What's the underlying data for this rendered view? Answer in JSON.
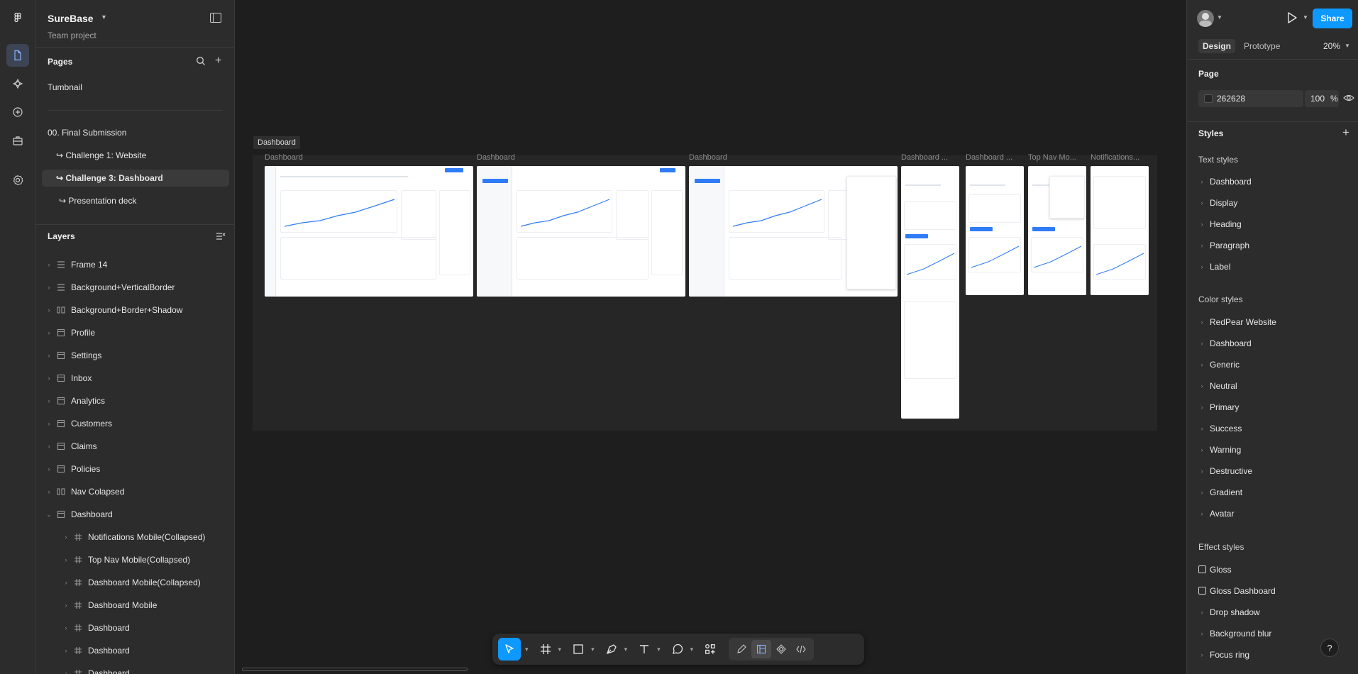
{
  "app": {
    "file_title": "SureBase",
    "team_label": "Team project"
  },
  "pages": {
    "header": "Pages",
    "items": [
      {
        "label": "Tumbnail"
      },
      {
        "label": "00. Final Submission"
      },
      {
        "label": "↪ Challenge 1: Website"
      },
      {
        "label": "↪ Challenge 3: Dashboard"
      },
      {
        "label": "↪ Presentation deck"
      }
    ]
  },
  "layers": {
    "header": "Layers",
    "items": [
      {
        "label": "Frame 14",
        "icon": "frame-stack-icon"
      },
      {
        "label": "Background+VerticalBorder",
        "icon": "frame-stack-icon"
      },
      {
        "label": "Background+Border+Shadow",
        "icon": "auto-layout-icon"
      },
      {
        "label": "Profile",
        "icon": "frame-icon"
      },
      {
        "label": "Settings",
        "icon": "frame-icon"
      },
      {
        "label": "Inbox",
        "icon": "frame-icon"
      },
      {
        "label": "Analytics",
        "icon": "frame-icon"
      },
      {
        "label": "Customers",
        "icon": "frame-icon"
      },
      {
        "label": "Claims",
        "icon": "frame-icon"
      },
      {
        "label": "Policies",
        "icon": "frame-icon"
      },
      {
        "label": "Nav Colapsed",
        "icon": "auto-layout-icon"
      },
      {
        "label": "Dashboard",
        "icon": "frame-icon"
      },
      {
        "label": "Notifications Mobile(Collapsed)",
        "icon": "hash-icon"
      },
      {
        "label": "Top Nav Mobile(Collapsed)",
        "icon": "hash-icon"
      },
      {
        "label": "Dashboard Mobile(Collapsed)",
        "icon": "hash-icon"
      },
      {
        "label": "Dashboard Mobile",
        "icon": "hash-icon"
      },
      {
        "label": "Dashboard",
        "icon": "hash-icon"
      },
      {
        "label": "Dashboard",
        "icon": "hash-icon"
      },
      {
        "label": "Dashboard",
        "icon": "hash-icon"
      }
    ]
  },
  "canvas": {
    "section_label": "Dashboard",
    "frame_labels": [
      "Dashboard",
      "Dashboard",
      "Dashboard",
      "Dashboard ...",
      "Dashboard ...",
      "Top Nav Mo...",
      "Notifications..."
    ]
  },
  "right": {
    "tabs": [
      "Design",
      "Prototype"
    ],
    "zoom": "20%",
    "share_label": "Share",
    "page_header": "Page",
    "page_color": "262628",
    "page_opacity": "100",
    "percent_sign": "%",
    "styles_header": "Styles",
    "text_styles_header": "Text styles",
    "text_styles": [
      "Dashboard",
      "Display",
      "Heading",
      "Paragraph",
      "Label"
    ],
    "color_styles_header": "Color styles",
    "color_styles": [
      "RedPear Website",
      "Dashboard",
      "Generic",
      "Neutral",
      "Primary",
      "Success",
      "Warning",
      "Destructive",
      "Gradient",
      "Avatar"
    ],
    "effect_styles_header": "Effect styles",
    "effect_styles": [
      "Gloss",
      "Gloss Dashboard",
      "Drop shadow",
      "Background blur",
      "Focus ring"
    ],
    "help_label": "?"
  },
  "colors": {
    "accent": "#0d99ff",
    "canvas_bg": "#1e1e1e",
    "panel_bg": "#2c2c2c"
  }
}
